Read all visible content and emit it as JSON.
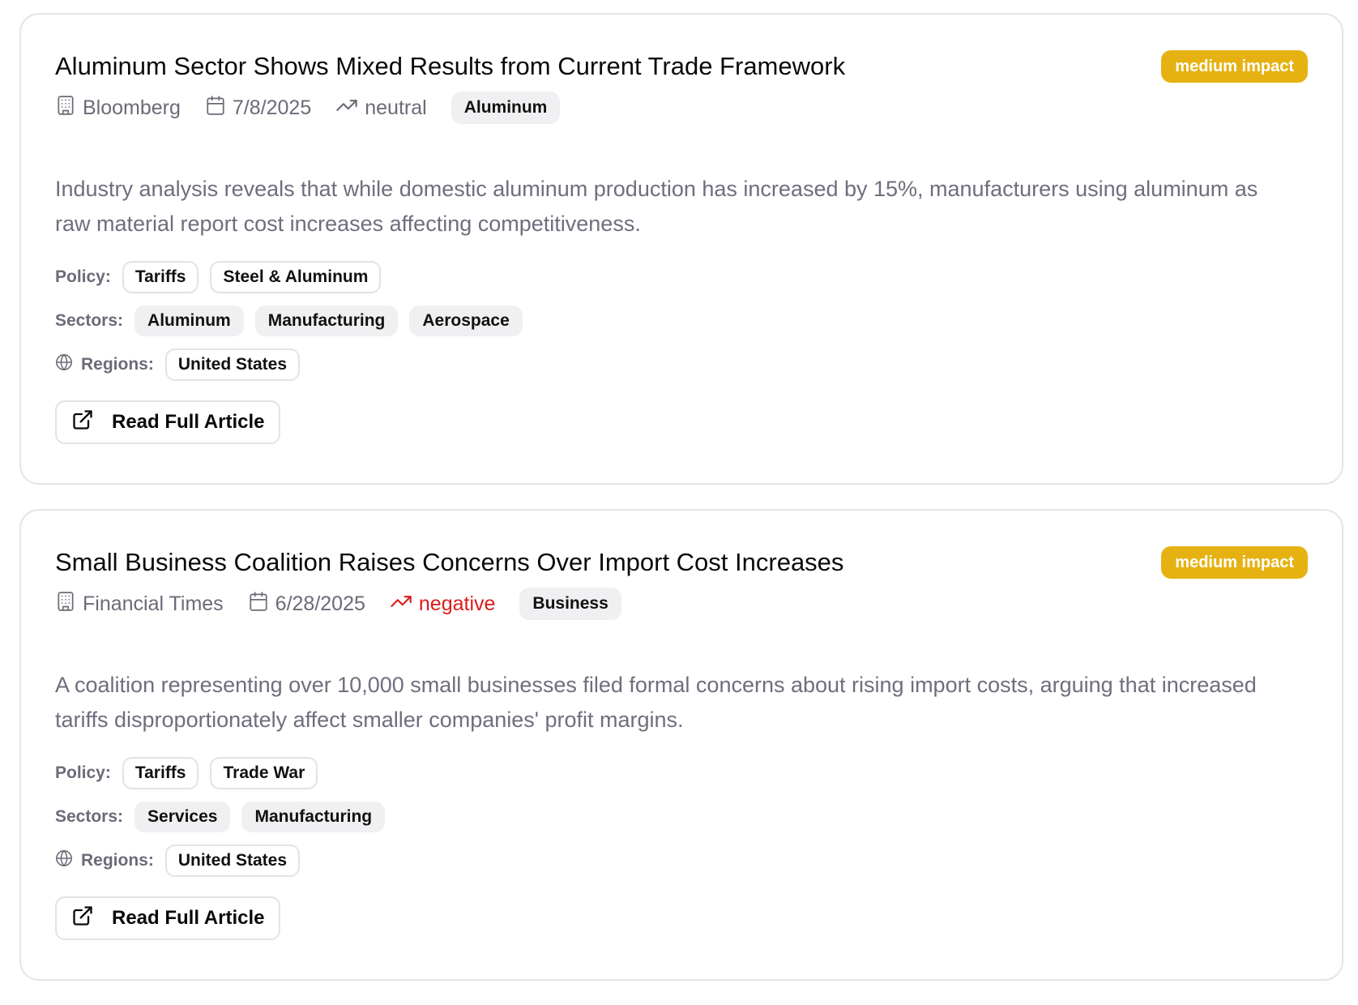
{
  "articles": [
    {
      "title": "Aluminum Sector Shows Mixed Results from Current Trade Framework",
      "impact": "medium impact",
      "source": "Bloomberg",
      "date": "7/8/2025",
      "sentiment": "neutral",
      "category": "Aluminum",
      "summary": "Industry analysis reveals that while domestic aluminum production has increased by 15%, manufacturers using aluminum as raw material report cost increases affecting competitiveness.",
      "policy_label": "Policy:",
      "policies": [
        "Tariffs",
        "Steel & Aluminum"
      ],
      "sectors_label": "Sectors:",
      "sectors": [
        "Aluminum",
        "Manufacturing",
        "Aerospace"
      ],
      "regions_label": "Regions:",
      "regions": [
        "United States"
      ],
      "read_label": "Read Full Article"
    },
    {
      "title": "Small Business Coalition Raises Concerns Over Import Cost Increases",
      "impact": "medium impact",
      "source": "Financial Times",
      "date": "6/28/2025",
      "sentiment": "negative",
      "category": "Business",
      "summary": "A coalition representing over 10,000 small businesses filed formal concerns about rising import costs, arguing that increased tariffs disproportionately affect smaller companies' profit margins.",
      "policy_label": "Policy:",
      "policies": [
        "Tariffs",
        "Trade War"
      ],
      "sectors_label": "Sectors:",
      "sectors": [
        "Services",
        "Manufacturing"
      ],
      "regions_label": "Regions:",
      "regions": [
        "United States"
      ],
      "read_label": "Read Full Article"
    }
  ],
  "colors": {
    "impact_medium": "#e6b212",
    "negative": "#dc1c1c",
    "muted": "#6b6b78"
  },
  "icons": {
    "source": "building-icon",
    "date": "calendar-icon",
    "sentiment": "trending-up-icon",
    "regions": "globe-icon",
    "read": "external-link-icon"
  }
}
